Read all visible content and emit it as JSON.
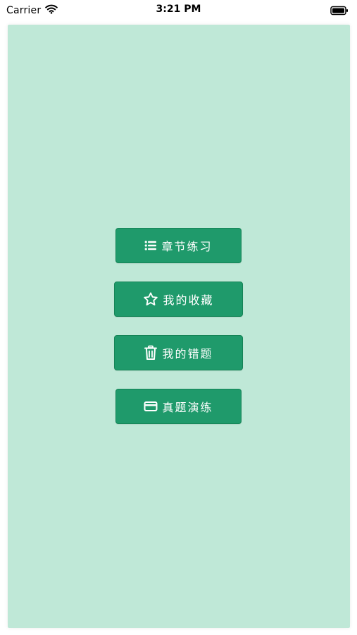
{
  "status_bar": {
    "carrier": "Carrier",
    "time": "3:21 PM",
    "icons": [
      "wifi-icon",
      "battery-icon"
    ]
  },
  "menu": {
    "chapter_practice": {
      "label": "章节练习",
      "icon": "list-icon"
    },
    "my_favorites": {
      "label": "我的收藏",
      "icon": "star-icon"
    },
    "my_mistakes": {
      "label": "我的错题",
      "icon": "trash-icon"
    },
    "past_exam_practice": {
      "label": "真题演练",
      "icon": "card-icon"
    }
  },
  "colors": {
    "background_panel": "#bfe8d7",
    "button_fill": "#1f9a6b",
    "button_text": "#ffffff"
  }
}
